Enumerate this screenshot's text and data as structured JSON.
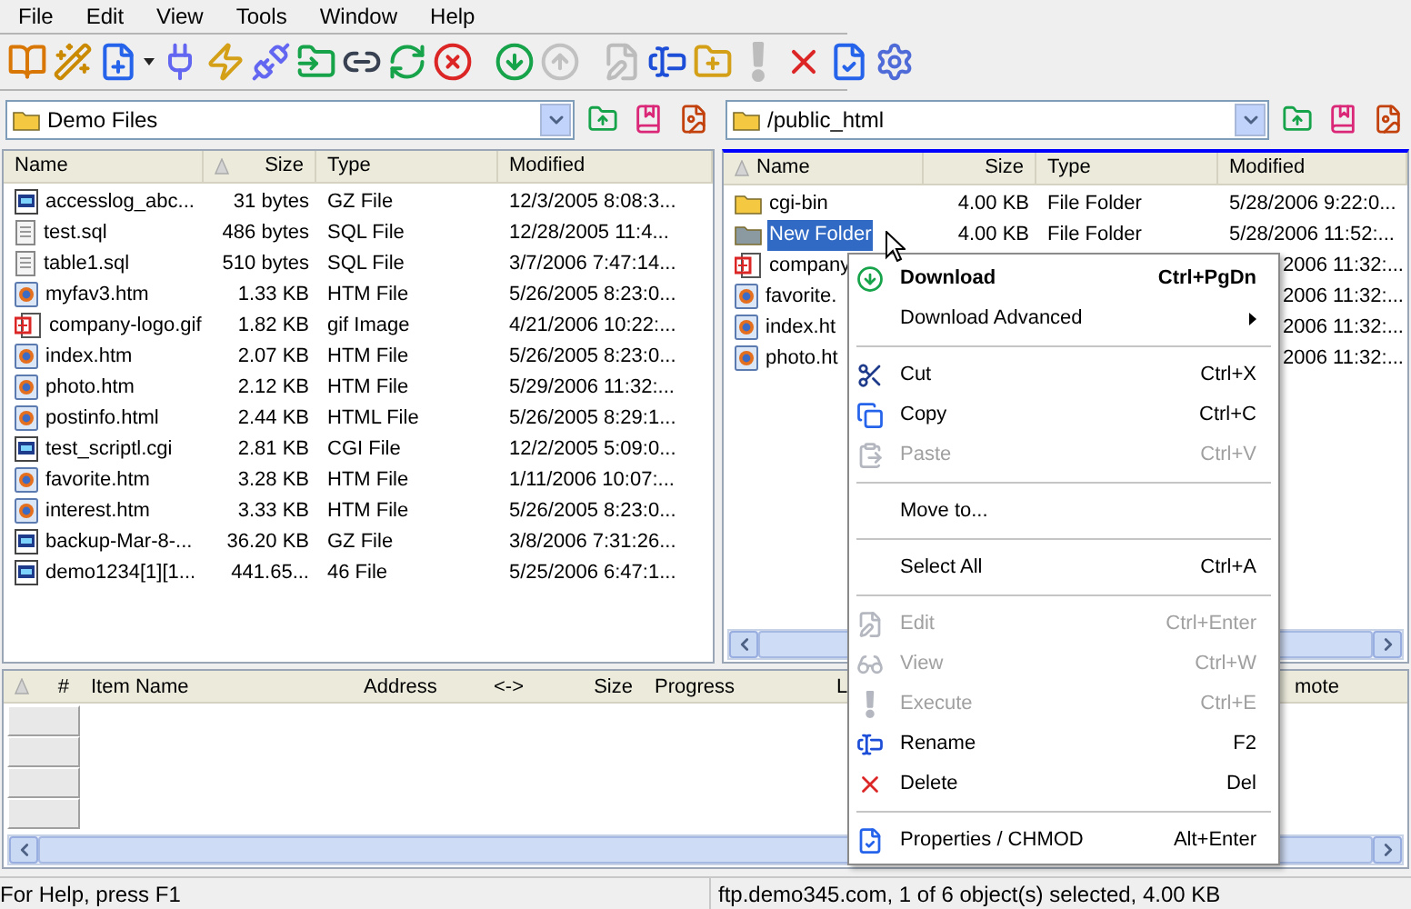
{
  "menu_bar": [
    "File",
    "Edit",
    "View",
    "Tools",
    "Window",
    "Help"
  ],
  "toolbar": [
    {
      "kind": "book",
      "disabled": false
    },
    {
      "kind": "wand",
      "disabled": false
    },
    {
      "kind": "new-file",
      "disabled": false
    },
    {
      "kind": "dropdown",
      "disabled": false
    },
    {
      "kind": "connect",
      "disabled": false
    },
    {
      "kind": "disconnect",
      "disabled": false
    },
    {
      "kind": "reconnect",
      "disabled": false
    },
    {
      "kind": "folder-in",
      "disabled": false
    },
    {
      "kind": "url",
      "disabled": false
    },
    {
      "kind": "refresh",
      "disabled": false
    },
    {
      "kind": "stop",
      "disabled": false
    },
    {
      "kind": "separator"
    },
    {
      "kind": "download",
      "disabled": false
    },
    {
      "kind": "upload",
      "disabled": true
    },
    {
      "kind": "separator"
    },
    {
      "kind": "edit",
      "disabled": true
    },
    {
      "kind": "rename",
      "disabled": false
    },
    {
      "kind": "new-folder",
      "disabled": false
    },
    {
      "kind": "execute",
      "disabled": true
    },
    {
      "kind": "delete",
      "disabled": false
    },
    {
      "kind": "properties",
      "disabled": false
    },
    {
      "kind": "settings",
      "disabled": false
    }
  ],
  "panels": [
    {
      "path": "Demo Files",
      "active": false,
      "columns": [
        {
          "label": "Name",
          "sorted": false
        },
        {
          "label": "Size",
          "sorted": true
        },
        {
          "label": "Type",
          "sorted": false
        },
        {
          "label": "Modified",
          "sorted": false
        }
      ],
      "rows": [
        {
          "kind": "gz",
          "name": "accesslog_abc...",
          "size": "31 bytes",
          "type": "GZ File",
          "modified": "12/3/2005 8:08:3...",
          "selected": false,
          "covered": false
        },
        {
          "kind": "sql",
          "name": "test.sql",
          "size": "486 bytes",
          "type": "SQL File",
          "modified": "12/28/2005 11:4...",
          "selected": false,
          "covered": false
        },
        {
          "kind": "sql",
          "name": "table1.sql",
          "size": "510 bytes",
          "type": "SQL File",
          "modified": "3/7/2006 7:47:14...",
          "selected": false,
          "covered": false
        },
        {
          "kind": "htm",
          "name": "myfav3.htm",
          "size": "1.33 KB",
          "type": "HTM File",
          "modified": "5/26/2005 8:23:0...",
          "selected": false,
          "covered": false
        },
        {
          "kind": "gif",
          "name": "company-logo.gif",
          "size": "1.82 KB",
          "type": "gif Image",
          "modified": "4/21/2006 10:22:...",
          "selected": false,
          "covered": false
        },
        {
          "kind": "htm",
          "name": "index.htm",
          "size": "2.07 KB",
          "type": "HTM File",
          "modified": "5/26/2005 8:23:0...",
          "selected": false,
          "covered": false
        },
        {
          "kind": "htm",
          "name": "photo.htm",
          "size": "2.12 KB",
          "type": "HTM File",
          "modified": "5/29/2006 11:32:...",
          "selected": false,
          "covered": false
        },
        {
          "kind": "htm",
          "name": "postinfo.html",
          "size": "2.44 KB",
          "type": "HTML File",
          "modified": "5/26/2005 8:29:1...",
          "selected": false,
          "covered": false
        },
        {
          "kind": "gz",
          "name": "test_scriptl.cgi",
          "size": "2.81 KB",
          "type": "CGI File",
          "modified": "12/2/2005 5:09:0...",
          "selected": false,
          "covered": false
        },
        {
          "kind": "htm",
          "name": "favorite.htm",
          "size": "3.28 KB",
          "type": "HTM File",
          "modified": "1/11/2006 10:07:...",
          "selected": false,
          "covered": false
        },
        {
          "kind": "htm",
          "name": "interest.htm",
          "size": "3.33 KB",
          "type": "HTM File",
          "modified": "5/26/2005 8:23:0...",
          "selected": false,
          "covered": false
        },
        {
          "kind": "gz",
          "name": "backup-Mar-8-...",
          "size": "36.20 KB",
          "type": "GZ File",
          "modified": "3/8/2006 7:31:26...",
          "selected": false,
          "covered": false
        },
        {
          "kind": "gz",
          "name": "demo1234[1][1...",
          "size": "441.65...",
          "type": "46 File",
          "modified": "5/25/2006 6:47:1...",
          "selected": false,
          "covered": false
        }
      ]
    },
    {
      "path": "/public_html",
      "active": true,
      "columns": [
        {
          "label": "Name",
          "sorted": true
        },
        {
          "label": "Size",
          "sorted": false
        },
        {
          "label": "Type",
          "sorted": false
        },
        {
          "label": "Modified",
          "sorted": false
        }
      ],
      "rows": [
        {
          "kind": "folder",
          "name": "cgi-bin",
          "size": "4.00 KB",
          "type": "File Folder",
          "modified": "5/28/2006 9:22:0...",
          "selected": false,
          "covered": false
        },
        {
          "kind": "folder-gray",
          "name": "New Folder",
          "size": "4.00 KB",
          "type": "File Folder",
          "modified": "5/28/2006 11:52:...",
          "selected": true,
          "covered": false
        },
        {
          "kind": "gif",
          "name": "company",
          "modified": "2006 11:32:...",
          "selected": false,
          "covered": true
        },
        {
          "kind": "htm",
          "name": "favorite.",
          "modified": "2006 11:32:...",
          "selected": false,
          "covered": true
        },
        {
          "kind": "htm",
          "name": "index.ht",
          "modified": "2006 11:32:...",
          "selected": false,
          "covered": true
        },
        {
          "kind": "htm",
          "name": "photo.ht",
          "modified": "2006 11:32:...",
          "selected": false,
          "covered": true
        }
      ]
    }
  ],
  "queue": {
    "columns": [
      {
        "label": "#",
        "sorted": true
      },
      {
        "label": "Item Name",
        "sorted": false
      },
      {
        "label": "Address",
        "sorted": false
      },
      {
        "label": "<->",
        "sorted": false
      },
      {
        "label": "Size",
        "sorted": false
      },
      {
        "label": "Progress",
        "sorted": false
      },
      {
        "label": "L",
        "sorted": false
      },
      {
        "label": "mote",
        "sorted": false
      }
    ]
  },
  "context_menu": [
    {
      "kind": "download",
      "label": "Download",
      "shortcut": "Ctrl+PgDn",
      "bold": true,
      "disabled": false
    },
    {
      "kind": "submenu",
      "label": "Download Advanced",
      "bold": false,
      "disabled": false
    },
    {
      "kind": "separator"
    },
    {
      "kind": "cut",
      "label": "Cut",
      "shortcut": "Ctrl+X",
      "bold": false,
      "disabled": false
    },
    {
      "kind": "copy",
      "label": "Copy",
      "shortcut": "Ctrl+C",
      "bold": false,
      "disabled": false
    },
    {
      "kind": "paste",
      "label": "Paste",
      "shortcut": "Ctrl+V",
      "bold": false,
      "disabled": true
    },
    {
      "kind": "separator"
    },
    {
      "kind": "plain",
      "label": "Move to...",
      "bold": false,
      "disabled": false
    },
    {
      "kind": "separator"
    },
    {
      "kind": "plain",
      "label": "Select All",
      "shortcut": "Ctrl+A",
      "bold": false,
      "disabled": false
    },
    {
      "kind": "separator"
    },
    {
      "kind": "edit",
      "label": "Edit",
      "shortcut": "Ctrl+Enter",
      "bold": false,
      "disabled": true
    },
    {
      "kind": "view",
      "label": "View",
      "shortcut": "Ctrl+W",
      "bold": false,
      "disabled": true
    },
    {
      "kind": "execute",
      "label": "Execute",
      "shortcut": "Ctrl+E",
      "bold": false,
      "disabled": true
    },
    {
      "kind": "rename",
      "label": "Rename",
      "shortcut": "F2",
      "bold": false,
      "disabled": false
    },
    {
      "kind": "delete",
      "label": "Delete",
      "shortcut": "Del",
      "bold": false,
      "disabled": false
    },
    {
      "kind": "separator"
    },
    {
      "kind": "properties",
      "label": "Properties / CHMOD",
      "shortcut": "Alt+Enter",
      "bold": false,
      "disabled": false
    }
  ],
  "status_bar": [
    "For Help, press F1",
    "ftp.demo345.com, 1 of 6 object(s) selected, 4.00 KB"
  ]
}
